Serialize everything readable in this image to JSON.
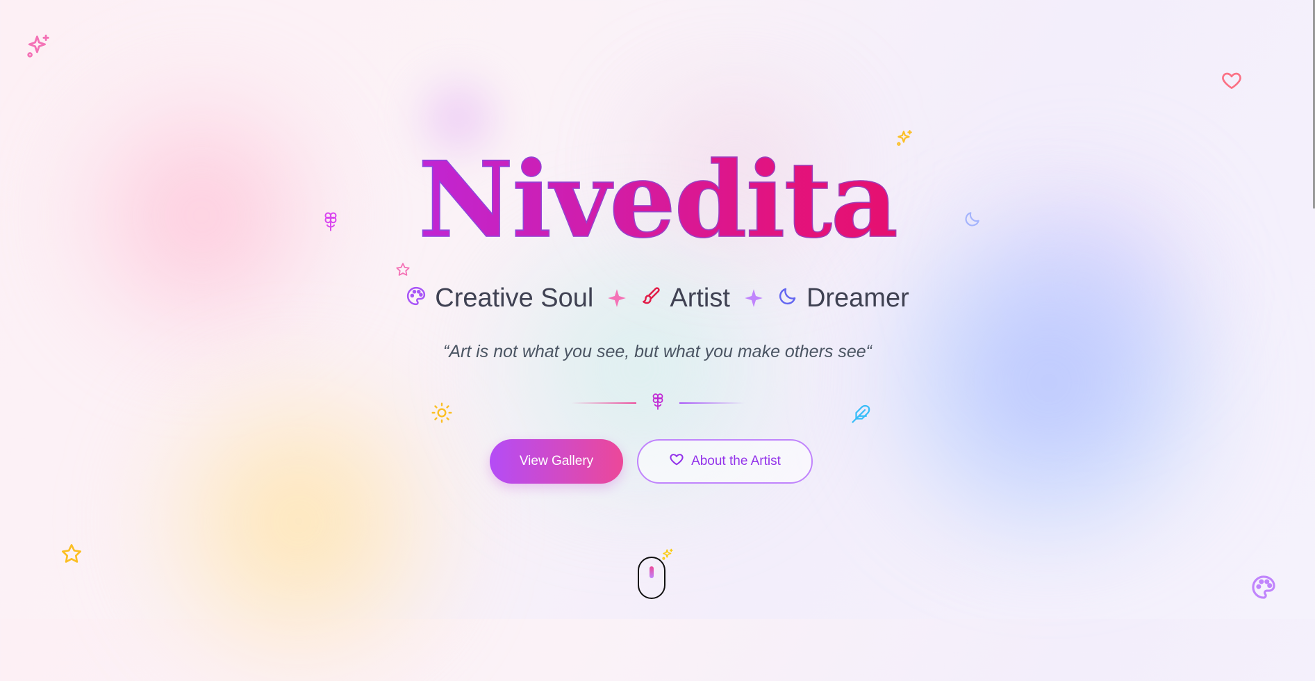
{
  "hero": {
    "name": "Nivedita",
    "roles": [
      {
        "icon": "palette-icon",
        "label": "Creative Soul"
      },
      {
        "icon": "paintbrush-icon",
        "label": "Artist"
      },
      {
        "icon": "moon-icon",
        "label": "Dreamer"
      }
    ],
    "quote": "“Art is not what you see, but what you make others see“"
  },
  "actions": {
    "primary_label": "View Gallery",
    "secondary_label": "About the Artist",
    "secondary_icon": "heart-icon"
  },
  "scroll_indicator": {
    "icon": "mouse-icon"
  },
  "decorations": [
    "sparkles-icon",
    "heart-icon",
    "flower-icon",
    "moon-icon",
    "star-icon",
    "sun-icon",
    "feather-icon",
    "palette-icon"
  ],
  "colors": {
    "title_gradient_start": "#9333ea",
    "title_gradient_mid": "#e3137c",
    "title_gradient_end": "#f0043f",
    "primary_button_start": "#b44cf6",
    "primary_button_end": "#ec4899",
    "secondary_button_text": "#9333ea",
    "tagline_text": "#3f4152",
    "quote_text": "#4b5563"
  }
}
